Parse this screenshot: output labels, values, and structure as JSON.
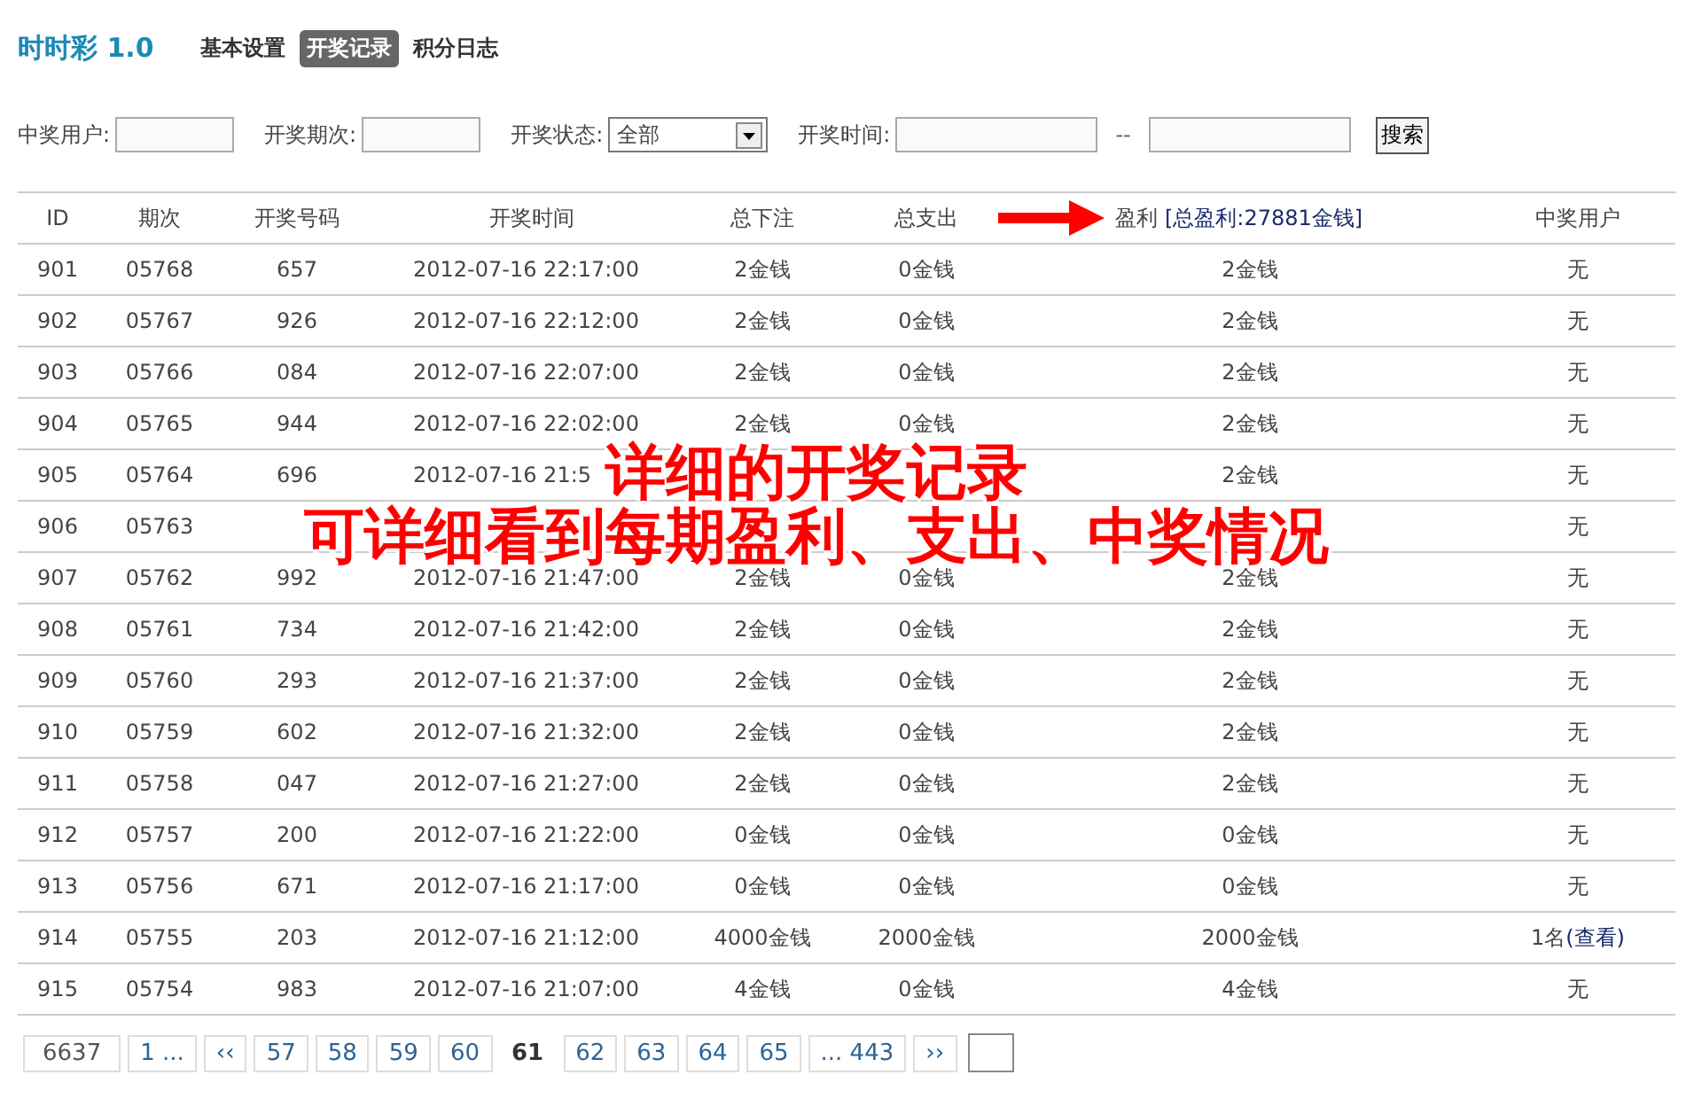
{
  "app_title": "时时彩 1.0",
  "tabs": [
    {
      "label": "基本设置",
      "selected": false
    },
    {
      "label": "开奖记录",
      "selected": true
    },
    {
      "label": "积分日志",
      "selected": false
    }
  ],
  "filters": {
    "user_label": "中奖用户:",
    "period_label": "开奖期次:",
    "status_label": "开奖状态:",
    "status_value": "全部",
    "time_label": "开奖时间:",
    "time_separator": "--",
    "search_button": "搜索"
  },
  "table": {
    "columns": [
      "ID",
      "期次",
      "开奖号码",
      "开奖时间",
      "总下注",
      "总支出",
      "盈利",
      "中奖用户"
    ],
    "profit_total": "[总盈利:27881金钱]",
    "rows": [
      {
        "cells": [
          "901",
          "05768",
          "657",
          "2012-07-16 22:17:00",
          "2金钱",
          "0金钱",
          "2金钱",
          "无"
        ]
      },
      {
        "cells": [
          "902",
          "05767",
          "926",
          "2012-07-16 22:12:00",
          "2金钱",
          "0金钱",
          "2金钱",
          "无"
        ]
      },
      {
        "cells": [
          "903",
          "05766",
          "084",
          "2012-07-16 22:07:00",
          "2金钱",
          "0金钱",
          "2金钱",
          "无"
        ]
      },
      {
        "cells": [
          "904",
          "05765",
          "944",
          "2012-07-16 22:02:00",
          "2金钱",
          "0金钱",
          "2金钱",
          "无"
        ]
      },
      {
        "cells": [
          "905",
          "05764",
          "696",
          "2012-07-16 21:5",
          null,
          null,
          "2金钱",
          "无"
        ]
      },
      {
        "cells": [
          "906",
          "05763",
          null,
          null,
          null,
          null,
          null,
          "无"
        ]
      },
      {
        "cells": [
          "907",
          "05762",
          "992",
          "2012-07-16 21:47:00",
          "2金钱",
          "0金钱",
          "2金钱",
          "无"
        ]
      },
      {
        "cells": [
          "908",
          "05761",
          "734",
          "2012-07-16 21:42:00",
          "2金钱",
          "0金钱",
          "2金钱",
          "无"
        ]
      },
      {
        "cells": [
          "909",
          "05760",
          "293",
          "2012-07-16 21:37:00",
          "2金钱",
          "0金钱",
          "2金钱",
          "无"
        ]
      },
      {
        "cells": [
          "910",
          "05759",
          "602",
          "2012-07-16 21:32:00",
          "2金钱",
          "0金钱",
          "2金钱",
          "无"
        ]
      },
      {
        "cells": [
          "911",
          "05758",
          "047",
          "2012-07-16 21:27:00",
          "2金钱",
          "0金钱",
          "2金钱",
          "无"
        ]
      },
      {
        "cells": [
          "912",
          "05757",
          "200",
          "2012-07-16 21:22:00",
          "0金钱",
          "0金钱",
          "0金钱",
          "无"
        ]
      },
      {
        "cells": [
          "913",
          "05756",
          "671",
          "2012-07-16 21:17:00",
          "0金钱",
          "0金钱",
          "0金钱",
          "无"
        ]
      },
      {
        "cells": [
          "914",
          "05755",
          "203",
          "2012-07-16 21:12:00",
          "4000金钱",
          "2000金钱",
          "2000金钱",
          "1名"
        ],
        "winner_link": "(查看)"
      },
      {
        "cells": [
          "915",
          "05754",
          "983",
          "2012-07-16 21:07:00",
          "4金钱",
          "0金钱",
          "4金钱",
          "无"
        ]
      }
    ]
  },
  "pagination": [
    {
      "label": "6637",
      "kind": "count"
    },
    {
      "label": "1 ...",
      "kind": "link",
      "selected": false
    },
    {
      "label": "‹‹",
      "kind": "link",
      "selected": false
    },
    {
      "label": "57",
      "kind": "link",
      "selected": false
    },
    {
      "label": "58",
      "kind": "link",
      "selected": false
    },
    {
      "label": "59",
      "kind": "link",
      "selected": false
    },
    {
      "label": "60",
      "kind": "link",
      "selected": false
    },
    {
      "label": "61",
      "kind": "link",
      "selected": true
    },
    {
      "label": "62",
      "kind": "link",
      "selected": false
    },
    {
      "label": "63",
      "kind": "link",
      "selected": false
    },
    {
      "label": "64",
      "kind": "link",
      "selected": false
    },
    {
      "label": "65",
      "kind": "link",
      "selected": false
    },
    {
      "label": "... 443",
      "kind": "link",
      "selected": false
    },
    {
      "label": "››",
      "kind": "link",
      "selected": false
    },
    {
      "kind": "jump"
    }
  ],
  "annotation": [
    "详细的开奖记录",
    "可详细看到每期盈利、支出、中奖情况"
  ]
}
